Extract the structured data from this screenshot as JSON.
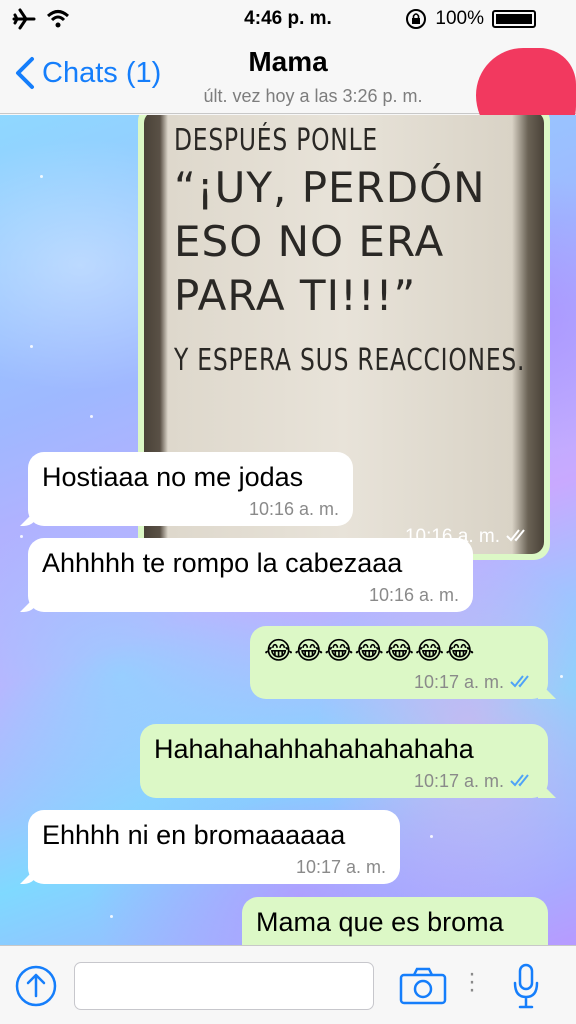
{
  "status_bar": {
    "time": "4:46 p. m.",
    "battery": "100%"
  },
  "nav": {
    "back_label": "Chats (1)",
    "contact_name": "Mama",
    "last_seen": "últ. vez hoy a las 3:26 p. m."
  },
  "image_message": {
    "text_lines": [
      "DESPUÉS PONLE",
      "“¡UY, PERDÓN",
      "ESO NO ERA",
      "PARA TI!!!”",
      "Y ESPERA SUS REACCIONES."
    ],
    "time": "10:16 a. m."
  },
  "messages": [
    {
      "direction": "in",
      "text": "Hostiaaa no me jodas",
      "time": "10:16 a. m."
    },
    {
      "direction": "in",
      "text": "Ahhhhh te rompo la cabezaaa",
      "time": "10:16 a. m."
    },
    {
      "direction": "out",
      "text": "😂😂😂😂😂😂😂",
      "time": "10:17 a. m."
    },
    {
      "direction": "out",
      "text": "Hahahahahhahahahahaha",
      "time": "10:17 a. m."
    },
    {
      "direction": "in",
      "text": "Ehhhh ni en bromaaaaaa",
      "time": "10:17 a. m."
    },
    {
      "direction": "out",
      "text": "Mama que es broma",
      "time": ""
    }
  ],
  "colors": {
    "accent": "#157efb",
    "outgoing_bubble": "#dcf8c6",
    "incoming_bubble": "#ffffff",
    "read_tick": "#4fa3f7"
  },
  "input_bar": {
    "icons": [
      "upload-icon",
      "camera-icon",
      "microphone-icon"
    ]
  }
}
